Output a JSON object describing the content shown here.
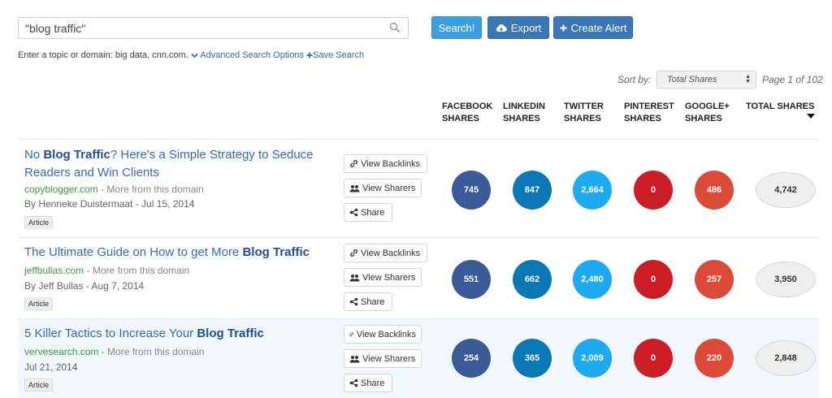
{
  "search": {
    "value": "\"blog traffic\"",
    "search_label": "Search!",
    "export_label": "Export",
    "alert_label": "Create Alert"
  },
  "helper": {
    "text": "Enter a topic or domain: big data, cnn.com.",
    "advanced_label": "Advanced Search Options",
    "save_label": "Save Search"
  },
  "sort": {
    "label": "Sort by:",
    "selected": "Total Shares",
    "page_info": "Page 1 of 102"
  },
  "columns": {
    "facebook": [
      "Facebook",
      "Shares"
    ],
    "linkedin": [
      "LinkedIn",
      "Shares"
    ],
    "twitter": [
      "Twitter",
      "Shares"
    ],
    "pinterest": [
      "Pinterest",
      "Shares"
    ],
    "googleplus": [
      "Google+",
      "Shares"
    ],
    "total": [
      "Total Shares"
    ]
  },
  "actions": {
    "backlinks": "View Backlinks",
    "sharers": "View Sharers",
    "share": "Share"
  },
  "colors": {
    "facebook": "#3b5a98",
    "linkedin": "#0a78b5",
    "twitter": "#1eaaf0",
    "pinterest": "#cc1d24",
    "googleplus": "#dc4a38"
  },
  "results": [
    {
      "title_pre": "No ",
      "title_bold": "Blog Traffic",
      "title_post": "? Here's a Simple Strategy to Seduce Readers and Win Clients",
      "domain": "copyblogger.com",
      "more": " - More from this domain",
      "byline": "By Henneke Duistermaat - Jul 15, 2014",
      "badge": "Article",
      "facebook": "745",
      "linkedin": "847",
      "twitter": "2,664",
      "pinterest": "0",
      "googleplus": "486",
      "total": "4,742"
    },
    {
      "title_pre": "The Ultimate Guide on How to get More ",
      "title_bold": "Blog Traffic",
      "title_post": "",
      "domain": "jeffbullas.com",
      "more": " - More from this domain",
      "byline": "By Jeff Bullas - Aug 7, 2014",
      "badge": "Article",
      "facebook": "551",
      "linkedin": "662",
      "twitter": "2,480",
      "pinterest": "0",
      "googleplus": "257",
      "total": "3,950"
    },
    {
      "title_pre": "5 Killer Tactics to Increase Your ",
      "title_bold": "Blog Traffic",
      "title_post": "",
      "domain": "vervesearch.com",
      "more": " - More from this domain",
      "byline": "Jul 21, 2014",
      "badge": "Article",
      "facebook": "254",
      "linkedin": "365",
      "twitter": "2,009",
      "pinterest": "0",
      "googleplus": "220",
      "total": "2,848"
    }
  ]
}
